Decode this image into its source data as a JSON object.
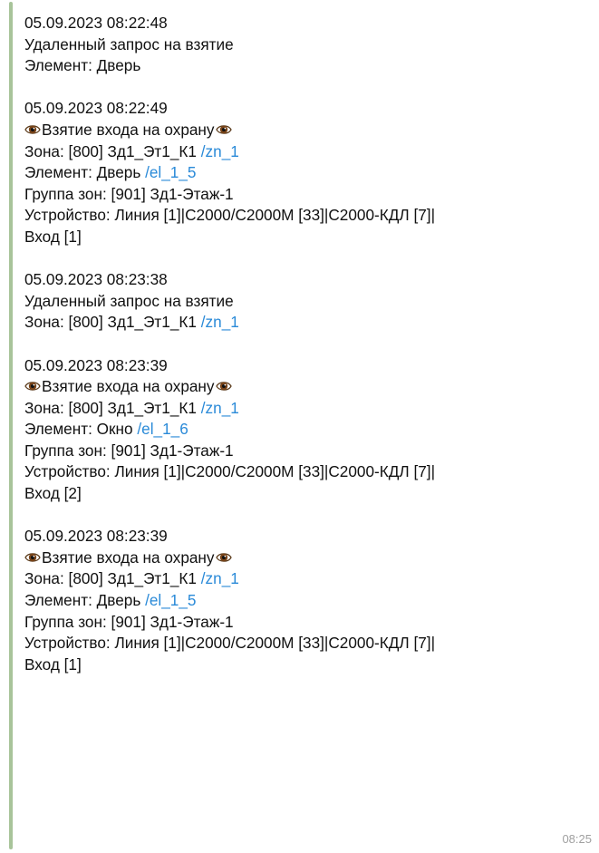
{
  "message": {
    "time": "08:25",
    "events": [
      {
        "lines": [
          {
            "text": "05.09.2023 08:22:48"
          },
          {
            "text": "Удаленный запрос на взятие"
          },
          {
            "text": "Элемент: Дверь"
          }
        ]
      },
      {
        "lines": [
          {
            "text": "05.09.2023 08:22:49"
          },
          {
            "text": "Взятие входа на охрану",
            "eyes": true
          },
          {
            "text": "Зона: [800] Зд1_Эт1_К1 ",
            "link": "/zn_1"
          },
          {
            "text": "Элемент: Дверь ",
            "link": "/el_1_5"
          },
          {
            "text": "Группа зон: [901] Зд1-Этаж-1"
          },
          {
            "text": "Устройство: Линия [1]|С2000/С2000М [33]|С2000-КДЛ [7]|"
          },
          {
            "text": "Вход [1]"
          }
        ]
      },
      {
        "lines": [
          {
            "text": "05.09.2023 08:23:38"
          },
          {
            "text": "Удаленный запрос на взятие"
          },
          {
            "text": "Зона: [800] Зд1_Эт1_К1 ",
            "link": "/zn_1"
          }
        ]
      },
      {
        "lines": [
          {
            "text": "05.09.2023 08:23:39"
          },
          {
            "text": "Взятие входа на охрану",
            "eyes": true
          },
          {
            "text": "Зона: [800] Зд1_Эт1_К1 ",
            "link": "/zn_1"
          },
          {
            "text": "Элемент: Окно ",
            "link": "/el_1_6"
          },
          {
            "text": "Группа зон: [901] Зд1-Этаж-1"
          },
          {
            "text": "Устройство: Линия [1]|С2000/С2000М [33]|С2000-КДЛ [7]|"
          },
          {
            "text": "Вход [2]"
          }
        ]
      },
      {
        "lines": [
          {
            "text": "05.09.2023 08:23:39"
          },
          {
            "text": "Взятие входа на охрану",
            "eyes": true
          },
          {
            "text": "Зона: [800] Зд1_Эт1_К1 ",
            "link": "/zn_1"
          },
          {
            "text": "Элемент: Дверь ",
            "link": "/el_1_5"
          },
          {
            "text": "Группа зон: [901] Зд1-Этаж-1"
          },
          {
            "text": "Устройство: Линия [1]|С2000/С2000М [33]|С2000-КДЛ [7]|"
          },
          {
            "text": "Вход [1]"
          }
        ]
      }
    ]
  },
  "icons": {
    "eye": "eye-icon"
  },
  "colors": {
    "link": "#2a8ad8",
    "accent_bar": "#a8c49a",
    "time": "#a0a0a0"
  }
}
